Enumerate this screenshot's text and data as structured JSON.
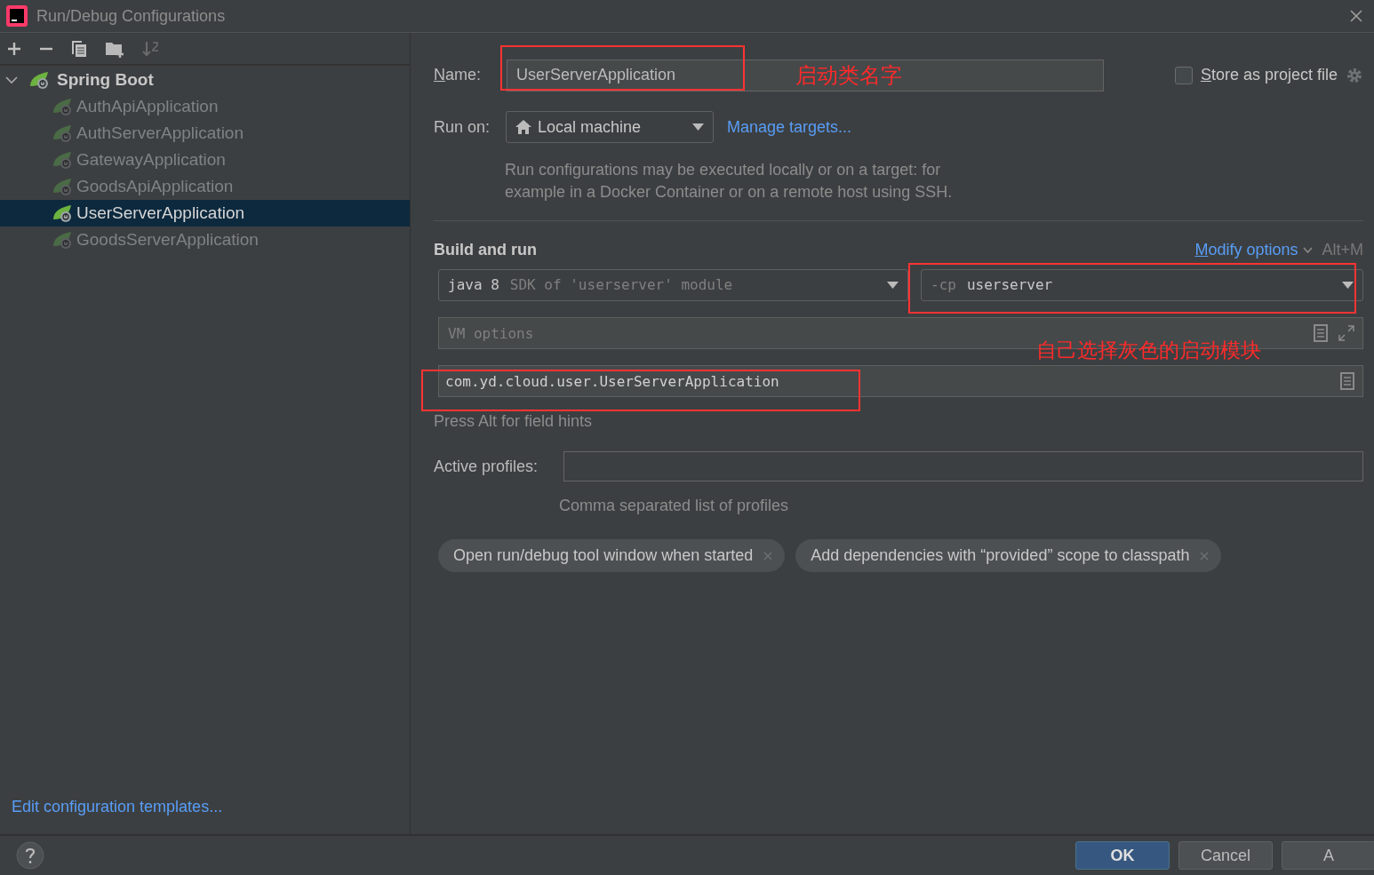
{
  "window": {
    "title": "Run/Debug Configurations"
  },
  "tree": {
    "label": "Spring Boot",
    "expanded": true,
    "children": [
      {
        "label": "AuthApiApplication",
        "selected": false,
        "greyed": true
      },
      {
        "label": "AuthServerApplication",
        "selected": false,
        "greyed": true
      },
      {
        "label": "GatewayApplication",
        "selected": false,
        "greyed": true
      },
      {
        "label": "GoodsApiApplication",
        "selected": false,
        "greyed": true
      },
      {
        "label": "UserServerApplication",
        "selected": true,
        "greyed": false
      },
      {
        "label": "GoodsServerApplication",
        "selected": false,
        "greyed": true
      }
    ]
  },
  "edit_templates_link": "Edit configuration templates...",
  "form": {
    "name": {
      "label": "Name:",
      "value": "UserServerApplication"
    },
    "store_as_project_file": {
      "label": "Store as project file",
      "checked": false
    },
    "run_on": {
      "label": "Run on:",
      "value": "Local machine",
      "link": "Manage targets..."
    },
    "run_on_hint": "Run configurations may be executed locally or on a target: for example in a Docker Container or on a remote host using SSH.",
    "section_title": "Build and run",
    "modify_options": {
      "label": "Modify options",
      "shortcut": "Alt+M"
    },
    "sdk": {
      "value": "java 8",
      "hint": "SDK of 'userserver' module"
    },
    "classpath": {
      "prefix": "-cp",
      "value": "userserver"
    },
    "vm_options": {
      "placeholder": "VM options"
    },
    "main_class": {
      "value": "com.yd.cloud.user.UserServerApplication"
    },
    "field_hint": "Press Alt for field hints",
    "active_profiles": {
      "label": "Active profiles:"
    },
    "profiles_hint": "Comma separated list of profiles",
    "chips": [
      "Open run/debug tool window when started",
      "Add dependencies with “provided” scope to classpath"
    ]
  },
  "annotations": [
    "启动类名字",
    "自己选择灰色的启动模块"
  ],
  "buttons": [
    {
      "label": "OK",
      "kind": "primary"
    },
    {
      "label": "Cancel",
      "kind": "normal"
    },
    {
      "label": "A",
      "kind": "normal"
    }
  ]
}
